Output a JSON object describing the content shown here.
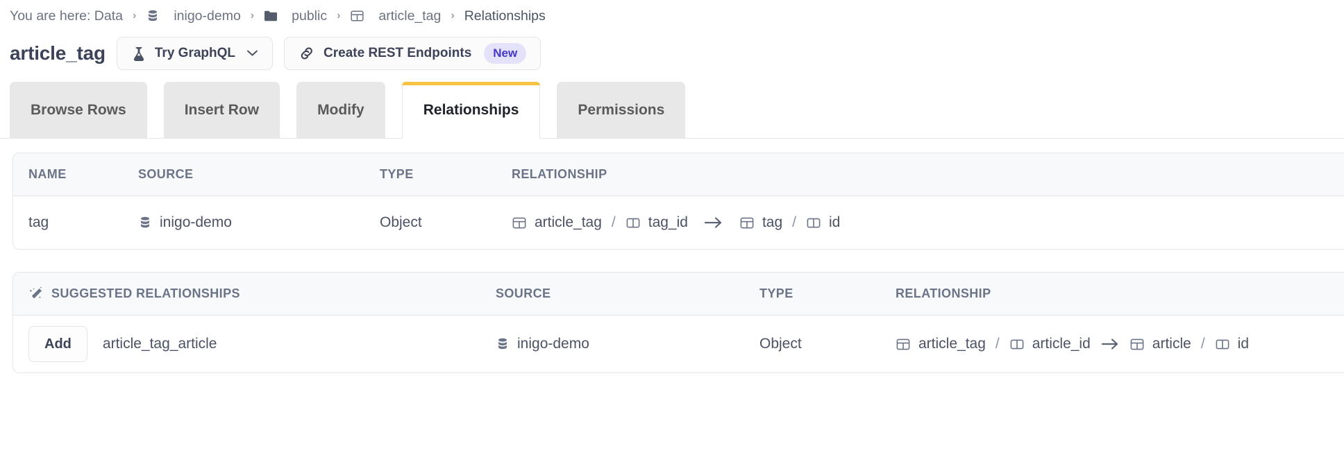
{
  "breadcrumb": {
    "prefix": "You are here: Data",
    "items": [
      {
        "label": "inigo-demo",
        "icon": "database-icon"
      },
      {
        "label": "public",
        "icon": "folder-icon"
      },
      {
        "label": "article_tag",
        "icon": "table-icon"
      },
      {
        "label": "Relationships",
        "icon": "none"
      }
    ],
    "separator": "›"
  },
  "header": {
    "title": "article_tag",
    "try_graphql_label": "Try GraphQL",
    "chevron": "∨",
    "create_rest_label": "Create REST Endpoints",
    "new_badge": "New"
  },
  "tabs": [
    {
      "label": "Browse Rows",
      "active": false
    },
    {
      "label": "Insert Row",
      "active": false
    },
    {
      "label": "Modify",
      "active": false
    },
    {
      "label": "Relationships",
      "active": true
    },
    {
      "label": "Permissions",
      "active": false
    }
  ],
  "relationships_table": {
    "columns": [
      "NAME",
      "SOURCE",
      "TYPE",
      "RELATIONSHIP"
    ],
    "rows": [
      {
        "name": "tag",
        "source": "inigo-demo",
        "type": "Object",
        "from_table": "article_tag",
        "from_column": "tag_id",
        "to_table": "tag",
        "to_column": "id",
        "slash": "/",
        "arrow": "→"
      }
    ]
  },
  "suggested_table": {
    "title": "SUGGESTED RELATIONSHIPS",
    "columns": [
      "SOURCE",
      "TYPE",
      "RELATIONSHIP"
    ],
    "rows": [
      {
        "add_label": "Add",
        "name": "article_tag_article",
        "source": "inigo-demo",
        "type": "Object",
        "from_table": "article_tag",
        "from_column": "article_id",
        "to_table": "article",
        "to_column": "id",
        "slash": "/",
        "arrow": "→"
      }
    ]
  },
  "colors": {
    "accent_tab": "#f6c344",
    "badge_bg": "#e4e2fb",
    "badge_text": "#4338ca",
    "icon": "#6b7487",
    "text": "#4b5263"
  }
}
